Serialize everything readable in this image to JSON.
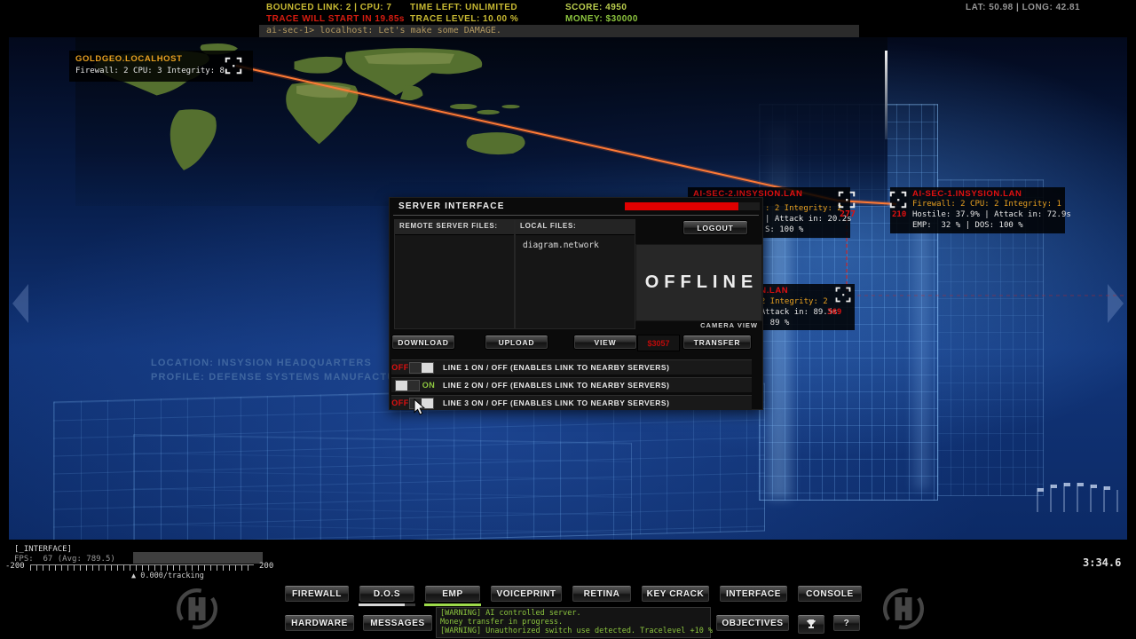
{
  "colors": {
    "accent_orange": "#ff6a2a",
    "alert_red": "#d81c10",
    "hud_yellow": "#c9ba33",
    "hud_green": "#8dc63f",
    "wire_blue": "#5aa0e8",
    "log_green": "#8cc63f"
  },
  "hud": {
    "bounced_link": "BOUNCED LINK: 2 | CPU: 7",
    "trace_warning": "TRACE WILL START IN 19.85s",
    "time_left": "TIME LEFT: UNLIMITED",
    "trace_level": "TRACE LEVEL: 10.00 %",
    "score": "SCORE: 4950",
    "money": "MONEY: $30000",
    "coords": "LAT: 50.98 | LONG: 42.81",
    "console_line": "ai-sec-1> localhost: Let's make some DAMAGE."
  },
  "map_label": {
    "location": "LOCATION: INSYSION HEADQUARTERS",
    "profile": "PROFILE: DEFENSE SYSTEMS MANUFACTURER"
  },
  "targets": {
    "goldgeo": {
      "title": "GOLDGEO.LOCALHOST",
      "stats": "Firewall: 2 CPU: 3 Integrity: 8"
    },
    "aisec2": {
      "title": "AI-SEC-2.INSYSION.LAN",
      "stat_fragment": ": 2 Integrity: 2",
      "attack_fragment": "| Attack in: 20.2s",
      "dos_fragment": "S: 100 %",
      "distance": "277"
    },
    "aisec1": {
      "title": "AI-SEC-1.INSYSION.LAN",
      "stats": "Firewall: 2 CPU: 2 Integrity: 1",
      "distance": "210",
      "hostile": "Hostile: 37.9% | Attack in: 72.9s",
      "emp_dos": "EMP:  32 % | DOS: 100 %"
    },
    "aisec3": {
      "title": "ION.LAN",
      "stat_fragment": ": 2 Integrity: 2",
      "attack_fragment": "| Attack in: 89.5s",
      "dos_fragment": "S:  89 %",
      "distance": "369"
    }
  },
  "server_window": {
    "title": "SERVER INTERFACE",
    "remote_files_header": "REMOTE SERVER FILES:",
    "local_files_header": "LOCAL FILES:",
    "local_files": [
      "diagram.network"
    ],
    "logout": "LOGOUT",
    "offline": "OFFLINE",
    "camera_view": "CAMERA VIEW",
    "download": "DOWNLOAD",
    "upload": "UPLOAD",
    "view": "VIEW",
    "transfer_amount": "$3057",
    "transfer": "TRANSFER",
    "lines": [
      {
        "state": "OFF",
        "label": "LINE 1 ON / OFF (ENABLES LINK TO NEARBY SERVERS)"
      },
      {
        "state": "ON",
        "label": "LINE 2 ON / OFF (ENABLES LINK TO NEARBY SERVERS)"
      },
      {
        "state": "OFF",
        "label": "LINE 3 ON / OFF (ENABLES LINK TO NEARBY SERVERS)"
      }
    ]
  },
  "status_bar": {
    "interface_label": "[_INTERFACE]",
    "fps": "FPS:  67 (Avg: 789.5)",
    "ruler_min": "-200",
    "ruler_max": "200",
    "tracking": "▲ 0.000/tracking",
    "timer": "3:34.6"
  },
  "toolbar": {
    "tools": [
      {
        "label": "FIREWALL"
      },
      {
        "label": "D.O.S"
      },
      {
        "label": "EMP"
      },
      {
        "label": "VOICEPRINT"
      },
      {
        "label": "RETINA"
      },
      {
        "label": "KEY CRACK"
      },
      {
        "label": "INTERFACE"
      },
      {
        "label": "CONSOLE"
      }
    ],
    "hardware": "HARDWARE",
    "messages": "MESSAGES",
    "objectives": "OBJECTIVES",
    "help": "?",
    "log": [
      "[WARNING] AI controlled server.",
      "Money transfer in progress.",
      "[WARNING] Unauthorized switch use detected. Tracelevel +10 %"
    ]
  }
}
